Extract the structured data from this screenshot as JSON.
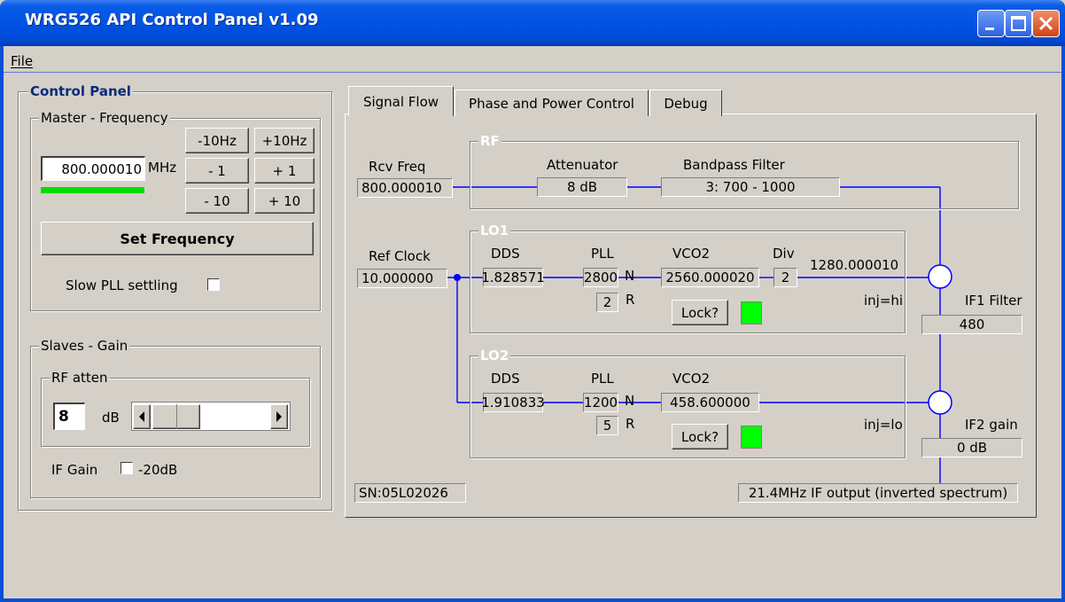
{
  "window": {
    "title": "WRG526 API Control Panel v1.09"
  },
  "menu": {
    "file": "File"
  },
  "control_panel": {
    "title": "Control Panel",
    "master": {
      "title": "Master - Frequency",
      "frequency_value": "800.000010",
      "unit": "MHz",
      "step_buttons": [
        "-10Hz",
        "+10Hz",
        "- 1",
        "+ 1",
        "- 10",
        "+ 10"
      ],
      "set_frequency": "Set Frequency",
      "slow_pll_label": "Slow PLL settling",
      "status_bar_color": "#00dd00"
    },
    "slaves": {
      "title": "Slaves - Gain",
      "rf_atten": {
        "title": "RF atten",
        "value": "8",
        "unit": "dB"
      },
      "if_gain_label": "IF Gain",
      "if_gain_option": "-20dB"
    }
  },
  "tabs": [
    "Signal Flow",
    "Phase and Power Control",
    "Debug"
  ],
  "signal_flow": {
    "rcv_freq": {
      "label": "Rcv Freq",
      "value": "800.000010"
    },
    "ref_clock": {
      "label": "Ref Clock",
      "value": "10.000000"
    },
    "rf": {
      "title": "RF",
      "attenuator_label": "Attenuator",
      "attenuator_value": "8 dB",
      "bandpass_label": "Bandpass Filter",
      "bandpass_value": "3: 700 - 1000"
    },
    "lo1": {
      "title": "LO1",
      "dds_label": "DDS",
      "dds_value": "1.828571",
      "pll_label": "PLL",
      "pll_n": "2800",
      "pll_r": "2",
      "n_label": "N",
      "r_label": "R",
      "vco_label": "VCO2",
      "vco_value": "2560.000020",
      "div_label": "Div",
      "div_value": "2",
      "output_value": "1280.000010",
      "injection": "inj=hi",
      "lock_button": "Lock?",
      "lock_color": "#00ff00"
    },
    "lo2": {
      "title": "LO2",
      "dds_label": "DDS",
      "dds_value": "1.910833",
      "pll_label": "PLL",
      "pll_n": "1200",
      "pll_r": "5",
      "n_label": "N",
      "r_label": "R",
      "vco_label": "VCO2",
      "vco_value": "458.600000",
      "injection": "inj=lo",
      "lock_button": "Lock?",
      "lock_color": "#00ff00"
    },
    "if1_filter": {
      "label": "IF1 Filter",
      "value": "480"
    },
    "if2_gain": {
      "label": "IF2 gain",
      "value": "0 dB"
    },
    "serial": "SN:05L02026",
    "if_output": "21.4MHz IF output (inverted spectrum)",
    "line_color": "#0000ff"
  }
}
